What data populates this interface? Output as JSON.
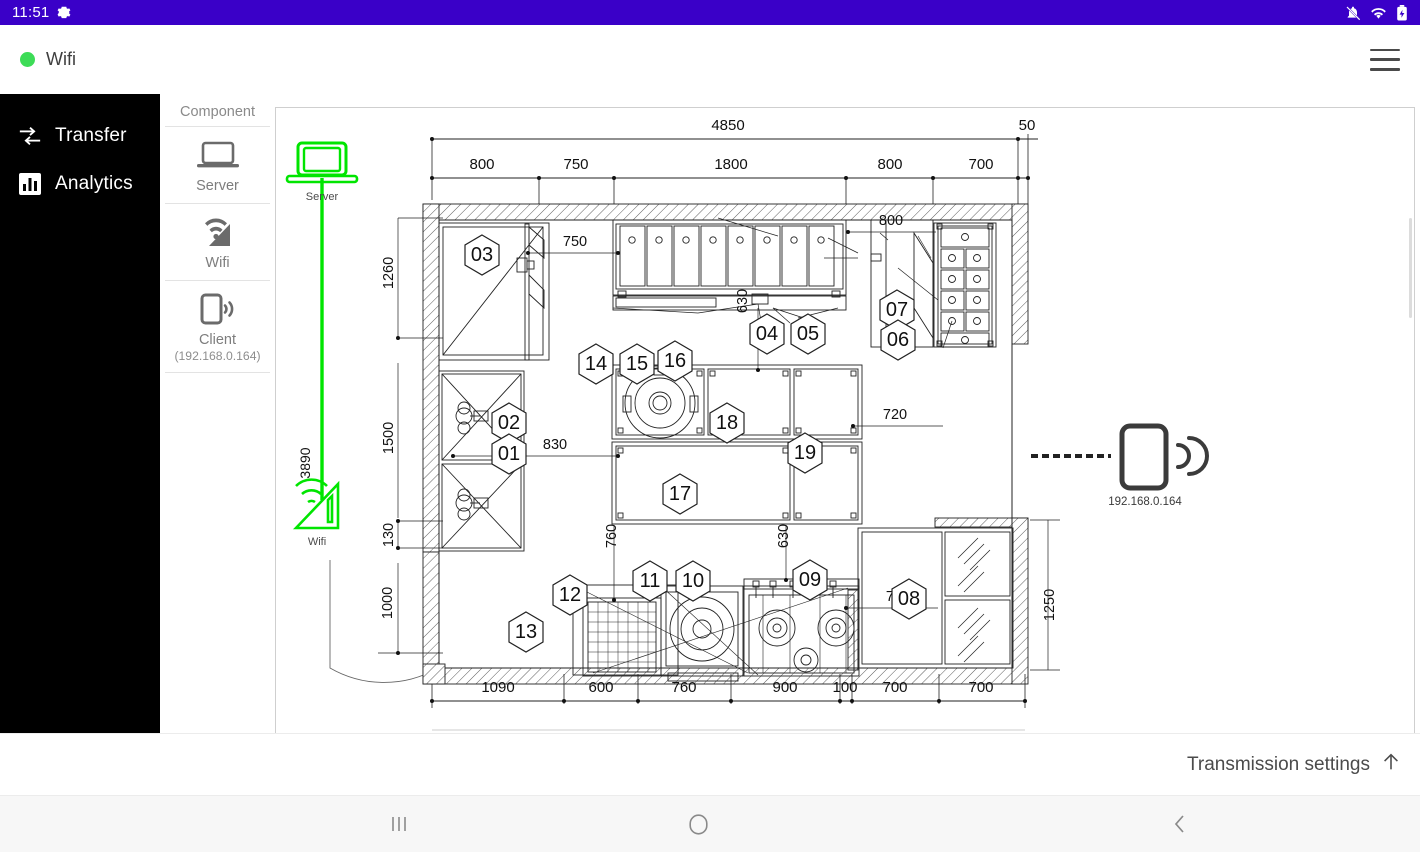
{
  "statusbar": {
    "time": "11:51",
    "gear_icon": "gear-icon",
    "icons": [
      "bell-off-icon",
      "wifi-icon",
      "battery-icon"
    ]
  },
  "appbar": {
    "connection_label": "Wifi",
    "status_color": "#3ddc57",
    "menu_icon": "hamburger-menu-icon"
  },
  "sidebar": {
    "items": [
      {
        "label": "Transfer",
        "icon": "transfer-icon"
      },
      {
        "label": "Analytics",
        "icon": "analytics-icon"
      }
    ]
  },
  "component_panel": {
    "title": "Component",
    "items": [
      {
        "label": "Server",
        "sub": "",
        "icon": "laptop-icon"
      },
      {
        "label": "Wifi",
        "sub": "",
        "icon": "wifi-signal-icon"
      },
      {
        "label": "Client",
        "sub": "(192.168.0.164)",
        "icon": "phone-signal-icon"
      }
    ]
  },
  "canvas": {
    "nodes": [
      {
        "id": "server",
        "label": "Server",
        "color": "#00e500",
        "icon": "laptop-icon"
      },
      {
        "id": "wifi",
        "label": "Wifi",
        "color": "#00e500",
        "icon": "wifi-router-icon"
      },
      {
        "id": "client",
        "label": "192.168.0.164",
        "color": "#3b3b3b",
        "icon": "phone-wifi-icon"
      }
    ],
    "link_dimension": "3890",
    "drawing": {
      "title": "kitchen-floor-plan",
      "top_overall": "4850",
      "top_dims": [
        "800",
        "750",
        "1800",
        "800",
        "700"
      ],
      "top_right_dim": "50",
      "bottom_dims": [
        "1090",
        "600",
        "760",
        "900",
        "100",
        "700",
        "700"
      ],
      "left_dims": [
        "1260",
        "1500",
        "130",
        "1000"
      ],
      "inner_dims": [
        "750",
        "800",
        "630",
        "830",
        "720",
        "760",
        "630",
        "700",
        "1250"
      ],
      "callouts": [
        "01",
        "02",
        "03",
        "04",
        "05",
        "06",
        "07",
        "08",
        "09",
        "10",
        "11",
        "12",
        "13",
        "14",
        "15",
        "16",
        "17",
        "18",
        "19"
      ]
    }
  },
  "transmission": {
    "label": "Transmission settings",
    "icon": "arrow-up-icon"
  },
  "navbar": {
    "recents_icon": "recents-icon",
    "home_icon": "home-icon",
    "back_icon": "back-icon"
  }
}
